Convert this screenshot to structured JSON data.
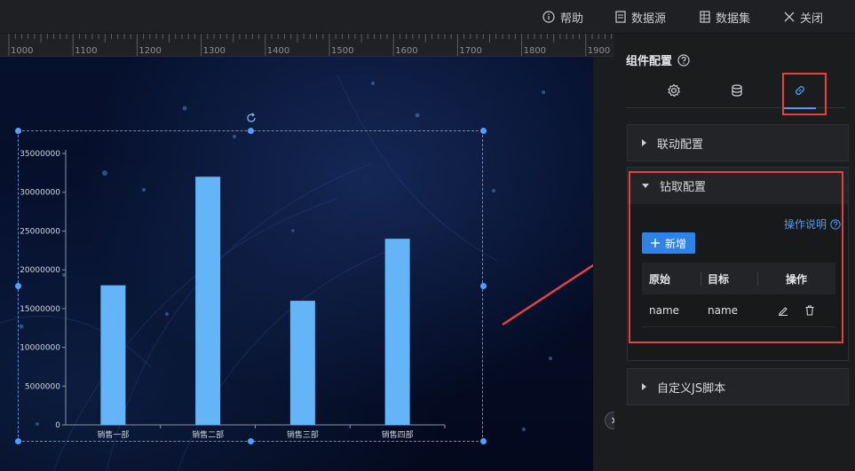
{
  "topbar": {
    "help": "帮助",
    "datasource": "数据源",
    "dataset": "数据集",
    "close": "关闭"
  },
  "ruler": {
    "ticks": [
      "1000",
      "1100",
      "1200",
      "1300",
      "1400",
      "1500",
      "1600",
      "1700",
      "1800",
      "1900"
    ]
  },
  "panel": {
    "title": "组件配置",
    "tabs": [
      "gear-icon",
      "database-icon",
      "link-icon"
    ],
    "active_tab": "link-icon",
    "sections": {
      "linkage": "联动配置",
      "drill": "钻取配置",
      "custom_js": "自定义JS脚本"
    },
    "drill": {
      "help_link": "操作说明",
      "add_button": "新增",
      "columns": [
        "原始",
        "目标",
        "操作"
      ],
      "rows": [
        {
          "source": "name",
          "target": "name"
        }
      ]
    }
  },
  "colors": {
    "accent": "#4e9bff",
    "bar": "#63b5f7",
    "highlight_red": "#e54141"
  },
  "chart_data": {
    "type": "bar",
    "categories": [
      "销售一部",
      "销售二部",
      "销售三部",
      "销售四部"
    ],
    "values": [
      18000000,
      32000000,
      16000000,
      24000000
    ],
    "yticks": [
      "0",
      "5000000",
      "10000000",
      "15000000",
      "20000000",
      "25000000",
      "30000000",
      "35000000"
    ],
    "ylim": [
      0,
      35000000
    ],
    "grid": false,
    "legend": "none"
  }
}
